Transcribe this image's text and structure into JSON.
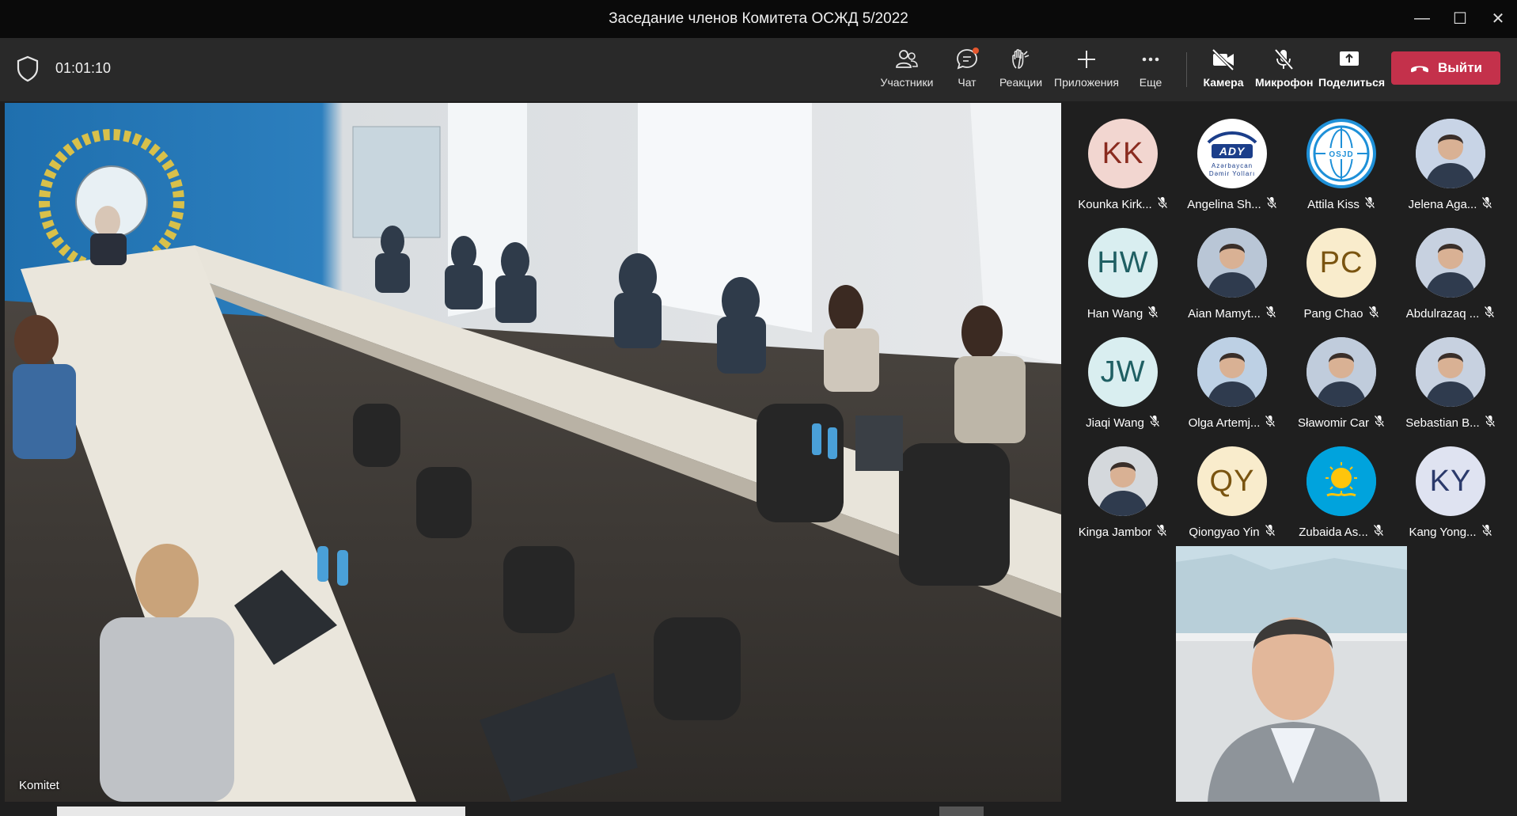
{
  "window": {
    "title": "Заседание членов Комитета ОСЖД 5/2022",
    "minimize_glyph": "—",
    "maximize_glyph": "☐",
    "close_glyph": "✕"
  },
  "toolbar": {
    "timer": "01:01:10",
    "participants_label": "Участники",
    "chat_label": "Чат",
    "reactions_label": "Реакции",
    "apps_label": "Приложения",
    "more_label": "Еще",
    "camera_label": "Камера",
    "mic_label": "Микрофон",
    "share_label": "Поделиться",
    "leave_label": "Выйти",
    "leave_color": "#c4314b"
  },
  "main_video": {
    "label": "Komitet"
  },
  "participants": [
    {
      "name": "Kounka Kirk...",
      "initials": "KK",
      "avatar_type": "initials",
      "bg": "#f2d6d0",
      "fg": "#8a2b1f"
    },
    {
      "name": "Angelina Sh...",
      "initials": "",
      "avatar_type": "logo-ady",
      "logo_text": "ADY",
      "logo_sub": "Azərbaycan Dəmir Yolları",
      "bg": "#ffffff"
    },
    {
      "name": "Attila Kiss",
      "initials": "",
      "avatar_type": "logo-osjd",
      "logo_text": "OSJD",
      "bg": "#1e90d8"
    },
    {
      "name": "Jelena Aga...",
      "initials": "",
      "avatar_type": "photo",
      "bg": "#c8d4e6"
    },
    {
      "name": "Han Wang",
      "initials": "HW",
      "avatar_type": "initials",
      "bg": "#d9eef0",
      "fg": "#1f5f63"
    },
    {
      "name": "Aian Mamyt...",
      "initials": "",
      "avatar_type": "photo",
      "bg": "#b9c6d6"
    },
    {
      "name": "Pang Chao",
      "initials": "PC",
      "avatar_type": "initials",
      "bg": "#f9eccc",
      "fg": "#7a5410"
    },
    {
      "name": "Abdulrazaq ...",
      "initials": "",
      "avatar_type": "photo",
      "bg": "#c7d1e0"
    },
    {
      "name": "Jiaqi Wang",
      "initials": "JW",
      "avatar_type": "initials",
      "bg": "#d9eef0",
      "fg": "#1f5f63"
    },
    {
      "name": "Olga Artemj...",
      "initials": "",
      "avatar_type": "photo",
      "bg": "#bdd0e4"
    },
    {
      "name": "Sławomir Car",
      "initials": "",
      "avatar_type": "photo",
      "bg": "#c0ccdc"
    },
    {
      "name": "Sebastian B...",
      "initials": "",
      "avatar_type": "photo",
      "bg": "#c7d1e0"
    },
    {
      "name": "Kinga Jambor",
      "initials": "",
      "avatar_type": "photo",
      "bg": "#d4d8dc"
    },
    {
      "name": "Qiongyao Yin",
      "initials": "QY",
      "avatar_type": "initials",
      "bg": "#f9eccc",
      "fg": "#7a5410"
    },
    {
      "name": "Zubaida As...",
      "initials": "",
      "avatar_type": "flag-kz",
      "bg": "#00a3dd"
    },
    {
      "name": "Kang Yong...",
      "initials": "KY",
      "avatar_type": "initials",
      "bg": "#dfe3f1",
      "fg": "#2b3a6b"
    }
  ],
  "self_view": {
    "label": "Attila Kiss"
  }
}
